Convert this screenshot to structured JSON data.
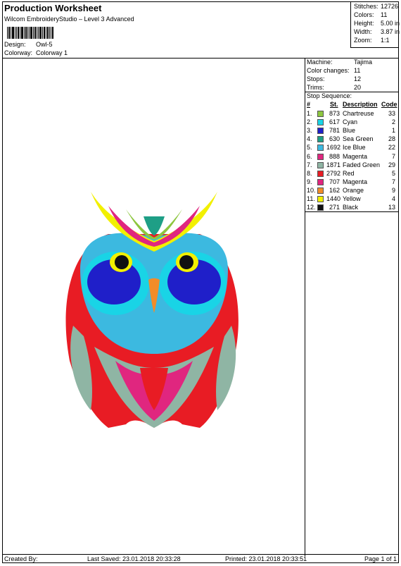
{
  "header": {
    "title": "Production Worksheet",
    "subtitle": "Wilcom EmbroideryStudio – Level 3 Advanced",
    "design_label": "Design:",
    "design_value": "Owl-5",
    "colorway_label": "Colorway:",
    "colorway_value": "Colorway 1"
  },
  "specs": [
    {
      "label": "Stitches:",
      "value": "12726"
    },
    {
      "label": "Colors:",
      "value": "11"
    },
    {
      "label": "Height:",
      "value": "5.00 in"
    },
    {
      "label": "Width:",
      "value": "3.87 in"
    },
    {
      "label": "Zoom:",
      "value": "1:1"
    }
  ],
  "machine": [
    {
      "label": "Machine:",
      "value": "Tajima"
    },
    {
      "label": "Color changes:",
      "value": "11"
    },
    {
      "label": "Stops:",
      "value": "12"
    },
    {
      "label": "Trims:",
      "value": "20"
    }
  ],
  "stop_sequence": {
    "heading": "Stop Sequence:",
    "columns": {
      "num": "#",
      "st": "St.",
      "desc": "Description",
      "code": "Code"
    },
    "rows": [
      {
        "num": "1.",
        "color": "#8dc63f",
        "st": "873",
        "desc": "Chartreuse",
        "code": "33"
      },
      {
        "num": "2.",
        "color": "#19d4e6",
        "st": "617",
        "desc": "Cyan",
        "code": "2"
      },
      {
        "num": "3.",
        "color": "#1f1fc9",
        "st": "781",
        "desc": "Blue",
        "code": "1"
      },
      {
        "num": "4.",
        "color": "#1e9f86",
        "st": "630",
        "desc": "Sea Green",
        "code": "28"
      },
      {
        "num": "5.",
        "color": "#3cb9e0",
        "st": "1692",
        "desc": "Ice Blue",
        "code": "22"
      },
      {
        "num": "6.",
        "color": "#e0267f",
        "st": "888",
        "desc": "Magenta",
        "code": "7"
      },
      {
        "num": "7.",
        "color": "#8fb5a4",
        "st": "1871",
        "desc": "Faded Green",
        "code": "29"
      },
      {
        "num": "8.",
        "color": "#e81c24",
        "st": "2792",
        "desc": "Red",
        "code": "5"
      },
      {
        "num": "9.",
        "color": "#e0267f",
        "st": "707",
        "desc": "Magenta",
        "code": "7"
      },
      {
        "num": "10.",
        "color": "#f28c28",
        "st": "162",
        "desc": "Orange",
        "code": "9"
      },
      {
        "num": "11.",
        "color": "#f2f000",
        "st": "1440",
        "desc": "Yellow",
        "code": "4"
      },
      {
        "num": "12.",
        "color": "#111111",
        "st": "271",
        "desc": "Black",
        "code": "13"
      }
    ]
  },
  "footer": {
    "created_by": "Created By:",
    "last_saved": "Last Saved: 23.01.2018 20:33:28",
    "printed": "Printed: 23.01.2018 20:33:51",
    "page": "Page 1 of 1"
  }
}
